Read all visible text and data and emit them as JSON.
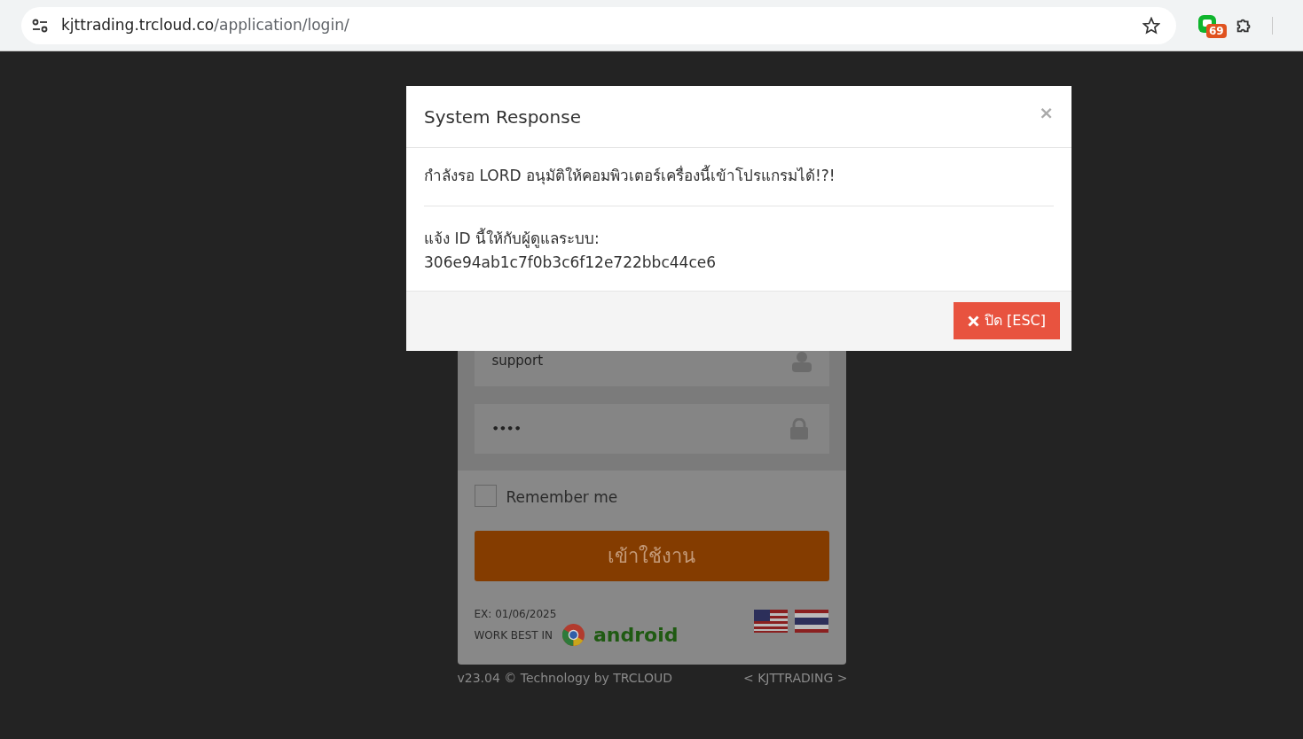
{
  "browser": {
    "url_host": "kjttrading.trcloud.co",
    "url_path": "/application/login/",
    "extension_badge": "69"
  },
  "modal": {
    "title": "System Response",
    "close": "×",
    "message": "กำลังรอ LORD อนุมัติให้คอมพิวเตอร์เครื่องนี้เข้าโปรแกรมได้!?!",
    "detail_label": "แจ้ง ID นี้ให้กับผู้ดูแลระบบ:",
    "detail_id": "306e94ab1c7f0b3c6f12e722bbc44ce6",
    "button": "ปิด [ESC]"
  },
  "login": {
    "username": "support",
    "password": "••••",
    "remember": {
      "label": "Remember me",
      "checked": false
    },
    "submit": "เข้าใช้งาน",
    "expiry": "EX: 01/06/2025",
    "works_best": "WORK BEST IN",
    "android": "android"
  },
  "footer": {
    "left": "v23.04 © Technology by TRCLOUD",
    "right": "< KJTTRADING >"
  }
}
